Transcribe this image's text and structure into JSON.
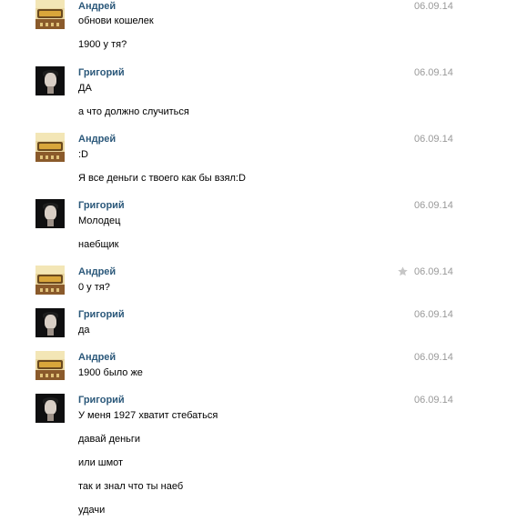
{
  "messages": [
    {
      "author": "Андрей",
      "avatar": "andrey",
      "time": "06.09.14",
      "lines": [
        "обнови кошелек",
        "1900 у тя?"
      ]
    },
    {
      "author": "Григорий",
      "avatar": "grigory",
      "time": "06.09.14",
      "lines": [
        "ДА",
        "а что должно случиться"
      ]
    },
    {
      "author": "Андрей",
      "avatar": "andrey",
      "time": "06.09.14",
      "lines": [
        ":D",
        "Я все деньги с твоего как бы взял:D"
      ]
    },
    {
      "author": "Григорий",
      "avatar": "grigory",
      "time": "06.09.14",
      "lines": [
        "Молодец",
        "наебщик"
      ]
    },
    {
      "author": "Андрей",
      "avatar": "andrey",
      "time": "06.09.14",
      "lines": [
        "0 у тя?"
      ],
      "starred": true
    },
    {
      "author": "Григорий",
      "avatar": "grigory",
      "time": "06.09.14",
      "lines": [
        "да"
      ]
    },
    {
      "author": "Андрей",
      "avatar": "andrey",
      "time": "06.09.14",
      "lines": [
        "1900 было же"
      ]
    },
    {
      "author": "Григорий",
      "avatar": "grigory",
      "time": "06.09.14",
      "lines": [
        "У меня 1927 хватит стебаться",
        "давай деньги",
        "или шмот",
        "так и знал что ты наеб",
        "удачи"
      ]
    }
  ],
  "icons": {
    "star": "star-icon"
  },
  "colors": {
    "author": "#2b587a",
    "timestamp": "#999999",
    "star": "#c6c6c6"
  }
}
